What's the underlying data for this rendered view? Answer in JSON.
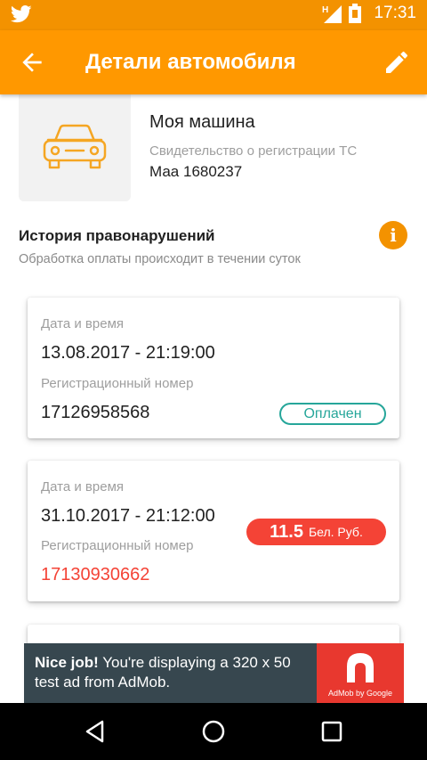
{
  "status_bar": {
    "time": "17:31",
    "network_label": "H",
    "app_icon": "twitter-bird-icon"
  },
  "app_bar": {
    "title": "Детали автомобиля",
    "back_icon": "arrow-back-icon",
    "edit_icon": "pencil-icon"
  },
  "car": {
    "name": "Моя машина",
    "doc_label": "Свидетельство о регистрации ТС",
    "doc_value": "Маа 1680237",
    "icon": "car-icon"
  },
  "history": {
    "title": "История правонарушений",
    "subtitle": "Обработка оплаты происходит в течении суток",
    "info_label": "i"
  },
  "violations": [
    {
      "datetime_label": "Дата и время",
      "datetime": "13.08.2017 - 21:19:00",
      "reg_label": "Регистрационный номер",
      "reg_number": "17126958568",
      "status": "Оплачен"
    },
    {
      "datetime_label": "Дата и время",
      "datetime": "31.10.2017 - 21:12:00",
      "reg_label": "Регистрационный номер",
      "reg_number": "17130930662",
      "amount": "11.5",
      "currency": "Бел. Руб."
    }
  ],
  "ad": {
    "headline": "Nice job!",
    "body": " You're displaying a 320 x 50 test ad from AdMob.",
    "logo_text": "AdMob by Google"
  },
  "colors": {
    "primary": "#ff9800",
    "status_bar": "#f39200",
    "paid": "#26a69a",
    "fine": "#f44336"
  }
}
